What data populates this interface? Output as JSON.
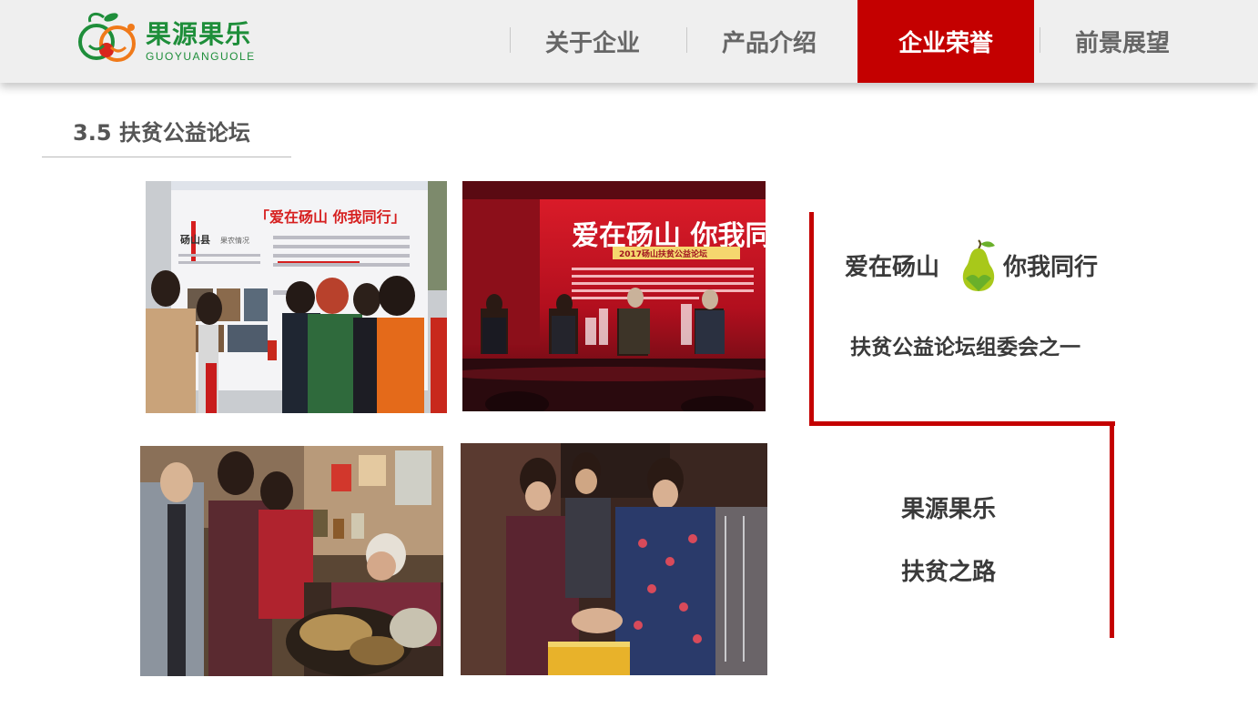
{
  "header": {
    "logo": {
      "name_cn": "果源果乐",
      "name_en": "GUOYUANGUOLE",
      "colors": {
        "green": "#1e8e3a",
        "orange": "#f07a1a",
        "red": "#d8261d"
      }
    },
    "nav": [
      {
        "label": "关于企业",
        "active": false
      },
      {
        "label": "产品介绍",
        "active": false
      },
      {
        "label": "企业荣誉",
        "active": true
      },
      {
        "label": "前景展望",
        "active": false
      }
    ],
    "active_color": "#c40000"
  },
  "section": {
    "title": "3.5 扶贫公益论坛"
  },
  "photos": {
    "p1": {
      "board_title": "「爱在砀山  你我同行」",
      "board_side": "砀山县",
      "board_side_sub": "果农情况"
    },
    "p2": {
      "banner_title": "爱在砀山  你我同行",
      "banner_subtitle": "2017砀山扶贫公益论坛"
    }
  },
  "panel": {
    "slogan_left": "爱在砀山",
    "slogan_right": "你我同行",
    "pear_icon": "pear-icon",
    "committee": "扶贫公益论坛组委会之一",
    "brand_line_1": "果源果乐",
    "brand_line_2": "扶贫之路",
    "accent_color": "#c40000"
  }
}
